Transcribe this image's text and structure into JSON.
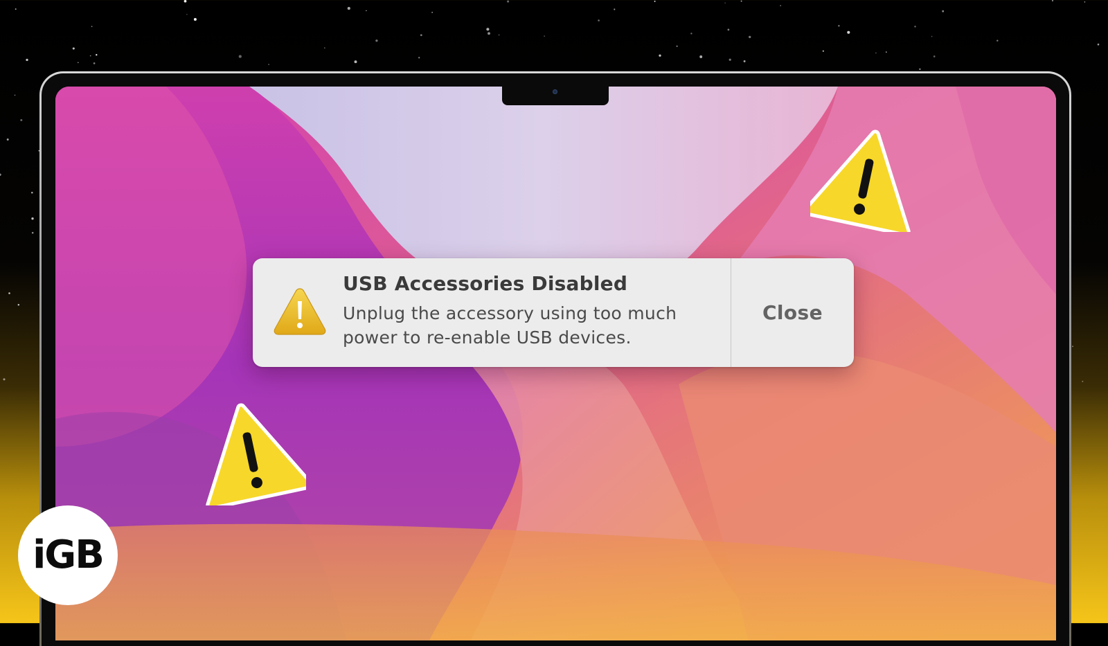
{
  "notification": {
    "title": "USB Accessories Disabled",
    "message": "Unplug the accessory using too much power to re-enable USB devices.",
    "close_label": "Close",
    "icon": "warning-triangle-icon"
  },
  "decorations": {
    "stickers": [
      "warning-triangle-icon",
      "warning-triangle-icon"
    ],
    "sticker_color": "#f7d72a",
    "notification_icon_color": "#e9b824"
  },
  "branding": {
    "logo_text": "iGB",
    "logo_color": "#ffffff"
  },
  "colors": {
    "wallpaper_primary": "#d63fb0",
    "wallpaper_secondary": "#f09a44",
    "background_bottom": "#f6c51a"
  }
}
